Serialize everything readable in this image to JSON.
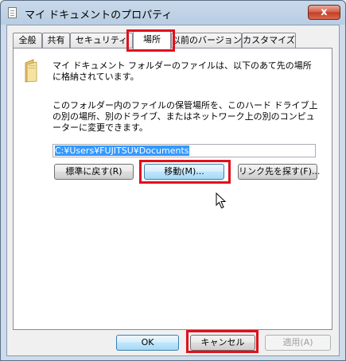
{
  "window": {
    "title": "マイ ドキュメントのプロパティ",
    "close_label": "x"
  },
  "tabs": [
    {
      "label": "全般"
    },
    {
      "label": "共有"
    },
    {
      "label": "セキュリティ"
    },
    {
      "label": "場所",
      "selected": true
    },
    {
      "label": "以前のバージョン"
    },
    {
      "label": "カスタマイズ"
    }
  ],
  "location": {
    "description1": "マイ ドキュメント フォルダーのファイルは、以下のあて先の場所に格納されています。",
    "description2": "このフォルダー内のファイルの保管場所を、このハード ドライブ上の別の場所、別のドライブ、またはネットワーク上の別のコンピューターに変更できます。",
    "path_value": "C:¥Users¥FUJITSU¥Documents",
    "restore_default_label": "標準に戻す(R)",
    "move_label": "移動(M)...",
    "find_target_label": "リンク先を探す(F)..."
  },
  "footer": {
    "ok_label": "OK",
    "cancel_label": "キャンセル",
    "apply_label": "適用(A)"
  },
  "colors": {
    "highlight": "#e0101c",
    "selection": "#3399ff"
  }
}
